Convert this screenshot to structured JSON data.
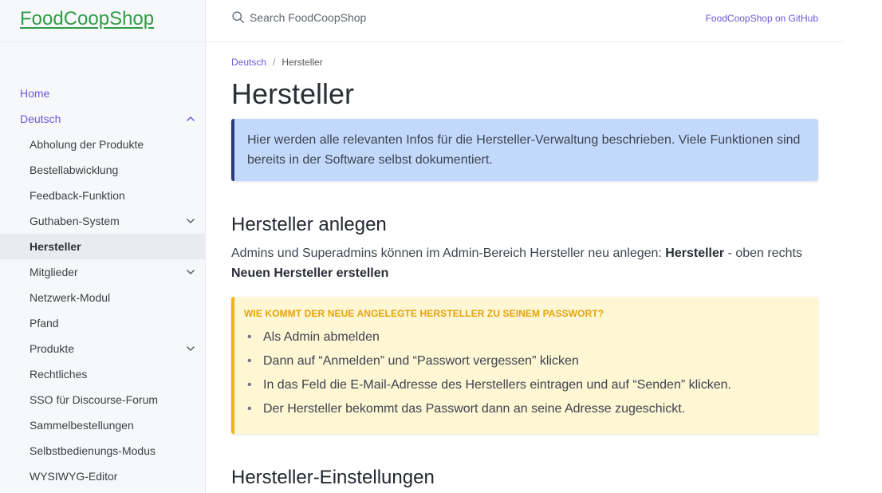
{
  "sidebar": {
    "logo": "FoodCoopShop",
    "items": [
      {
        "label": "Home",
        "level": "top",
        "chevron": null
      },
      {
        "label": "Deutsch",
        "level": "top",
        "chevron": "up"
      },
      {
        "label": "Abholung der Produkte",
        "level": "sub",
        "chevron": null
      },
      {
        "label": "Bestellabwicklung",
        "level": "sub",
        "chevron": null
      },
      {
        "label": "Feedback-Funktion",
        "level": "sub",
        "chevron": null
      },
      {
        "label": "Guthaben-System",
        "level": "sub",
        "chevron": "down"
      },
      {
        "label": "Hersteller",
        "level": "sub",
        "chevron": null,
        "active": true
      },
      {
        "label": "Mitglieder",
        "level": "sub",
        "chevron": "down"
      },
      {
        "label": "Netzwerk-Modul",
        "level": "sub",
        "chevron": null
      },
      {
        "label": "Pfand",
        "level": "sub",
        "chevron": null
      },
      {
        "label": "Produkte",
        "level": "sub",
        "chevron": "down"
      },
      {
        "label": "Rechtliches",
        "level": "sub",
        "chevron": null
      },
      {
        "label": "SSO für Discourse-Forum",
        "level": "sub",
        "chevron": null
      },
      {
        "label": "Sammelbestellungen",
        "level": "sub",
        "chevron": null
      },
      {
        "label": "Selbstbedienungs-Modus",
        "level": "sub",
        "chevron": null
      },
      {
        "label": "WYSIWYG-Editor",
        "level": "sub",
        "chevron": null
      }
    ]
  },
  "header": {
    "search_placeholder": "Search FoodCoopShop",
    "github_link": "FoodCoopShop on GitHub"
  },
  "breadcrumb": {
    "parent": "Deutsch",
    "separator": "/",
    "current": "Hersteller"
  },
  "main": {
    "title": "Hersteller",
    "info": "Hier werden alle relevanten Infos für die Hersteller-Verwaltung beschrieben. Viele Funktionen sind bereits in der Software selbst dokumentiert.",
    "section1": {
      "heading": "Hersteller anlegen",
      "text_before": "Admins und Superadmins können im Admin-Bereich Hersteller neu anlegen: ",
      "bold1": "Hersteller",
      "text_middle": " - oben rechts ",
      "bold2": "Neuen Hersteller erstellen"
    },
    "warning": {
      "title": "WIE KOMMT DER NEUE ANGELEGTE HERSTELLER ZU SEINEM PASSWORT?",
      "bullet": "•",
      "items": [
        "Als Admin abmelden",
        "Dann auf “Anmelden” und “Passwort vergessen” klicken",
        "In das Feld die E-Mail-Adresse des Herstellers eintragen und auf “Senden” klicken.",
        "Der Hersteller bekommt das Passwort dann an seine Adresse zugeschickt."
      ]
    },
    "section2": {
      "heading": "Hersteller-Einstellungen"
    }
  },
  "colors": {
    "accent": "#6f57d9",
    "logo": "#2e9c48",
    "info_bg": "#c2d9fb",
    "info_border": "#2b3a7a",
    "warning_bg": "#fff6d3",
    "warning_border": "#f0b419",
    "warning_title": "#e6a30c"
  },
  "icons": {
    "search": "search-icon",
    "chevron_up": "chevron-up-icon",
    "chevron_down": "chevron-down-icon"
  }
}
